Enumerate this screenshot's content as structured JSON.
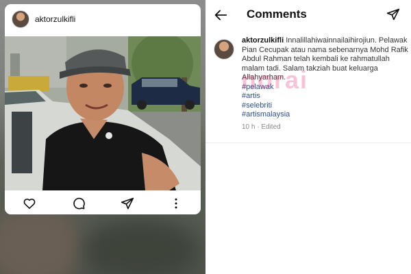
{
  "post": {
    "username": "aktorzulkifli",
    "icons": [
      "heart-icon",
      "comment-icon",
      "share-icon",
      "more-icon"
    ]
  },
  "comments_screen": {
    "title": "Comments",
    "comment": {
      "username": "aktorzulkifli",
      "text": "Innalillahiwainnailaihirojiun. Pelawak Pian Cecupak atau nama sebenarnya Mohd Rafik Abdul Rahman telah kembali ke rahmatullah malam tadi. Salam takziah buat keluarga Allahyarham.",
      "hashtags": [
        "#pelawak",
        "#artis",
        "#selebriti",
        "#artismalaysia"
      ],
      "meta": "10 h · Edited"
    },
    "watermark": "norai"
  },
  "colors": {
    "hashtag": "#2a4f8e",
    "watermark": "#e6286e"
  }
}
